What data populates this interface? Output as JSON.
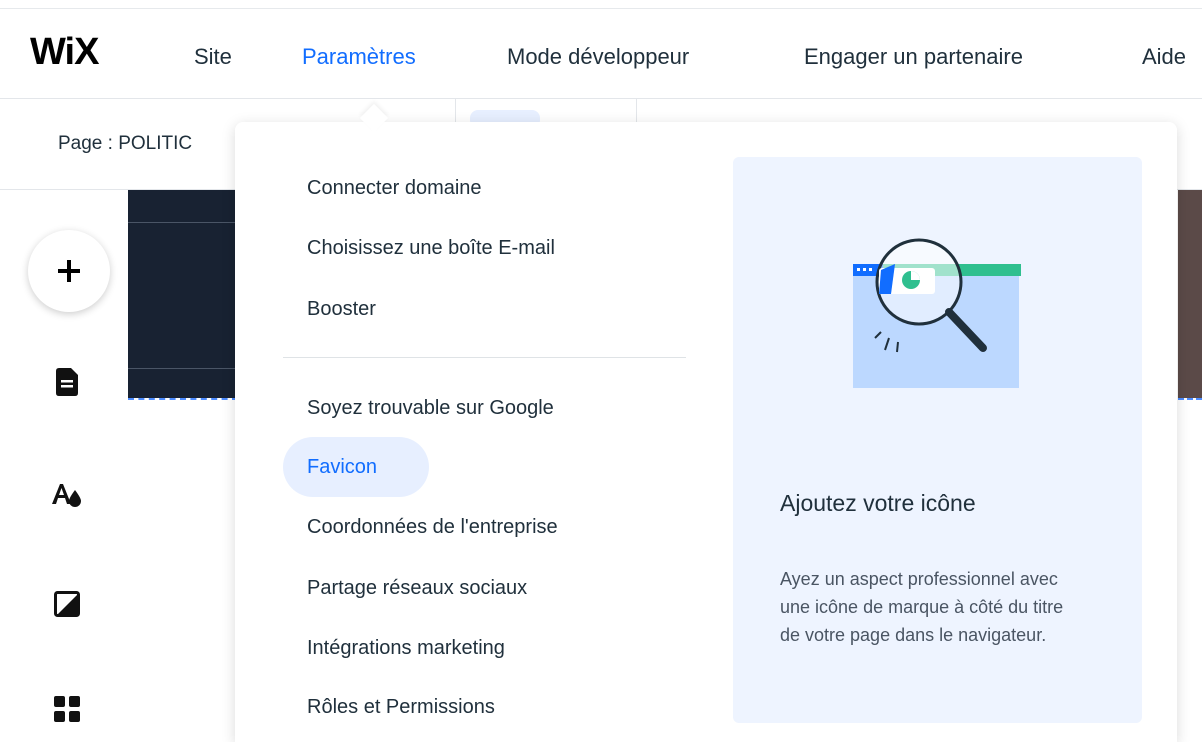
{
  "topbar": {
    "logo": "WiX",
    "nav": [
      "Site",
      "Paramètres",
      "Mode développeur",
      "Engager un partenaire",
      "Aide"
    ],
    "active_nav": "Paramètres"
  },
  "secondbar": {
    "page_label": "Page : POLITIC"
  },
  "dropdown": {
    "items": [
      "Connecter domaine",
      "Choisissez une boîte E-mail",
      "Booster",
      "Soyez trouvable sur Google",
      "Favicon",
      "Coordonnées de l'entreprise",
      "Partage réseaux sociaux",
      "Intégrations marketing",
      "Rôles et Permissions"
    ],
    "selected": "Favicon"
  },
  "preview": {
    "title": "Ajoutez votre icône",
    "description": "Ayez un aspect professionnel avec une icône de marque à côté du titre de votre page dans le navigateur.",
    "illustration_icon": "magnifier-favicon-icon"
  },
  "leftrail": {
    "icons": [
      "plus-icon",
      "page-icon",
      "theme-icon",
      "background-icon",
      "apps-icon"
    ]
  },
  "colors": {
    "accent": "#116dff",
    "highlight": "#e7efff",
    "preview_bg": "#eef4ff",
    "text": "#20303c"
  }
}
